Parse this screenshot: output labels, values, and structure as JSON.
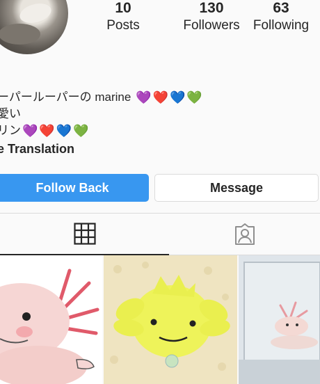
{
  "profile": {
    "stats": [
      {
        "key": "posts",
        "count": "10",
        "label": "Posts"
      },
      {
        "key": "followers",
        "count": "130",
        "label": "Followers"
      },
      {
        "key": "following",
        "count": "63",
        "label": "Following"
      }
    ],
    "bio": {
      "line1": "ーパールーパーの marine",
      "line2": "愛い",
      "line3": "リン",
      "translation": "e Translation"
    },
    "hearts": [
      "💜",
      "❤️",
      "💙",
      "💚"
    ],
    "actions": {
      "follow_back": "Follow Back",
      "message": "Message"
    }
  },
  "tabs": [
    {
      "name": "grid",
      "icon": "grid-icon",
      "selected": true
    },
    {
      "name": "tagged",
      "icon": "tagged-person-icon",
      "selected": false
    }
  ],
  "posts": [
    {
      "name": "axolotl-drawing"
    },
    {
      "name": "yellow-axolotl-figure"
    },
    {
      "name": "axolotl-photo"
    }
  ],
  "colors": {
    "accent": "#3897f0",
    "text": "#262626",
    "border": "#dbdbdb",
    "background": "#fafafa"
  }
}
